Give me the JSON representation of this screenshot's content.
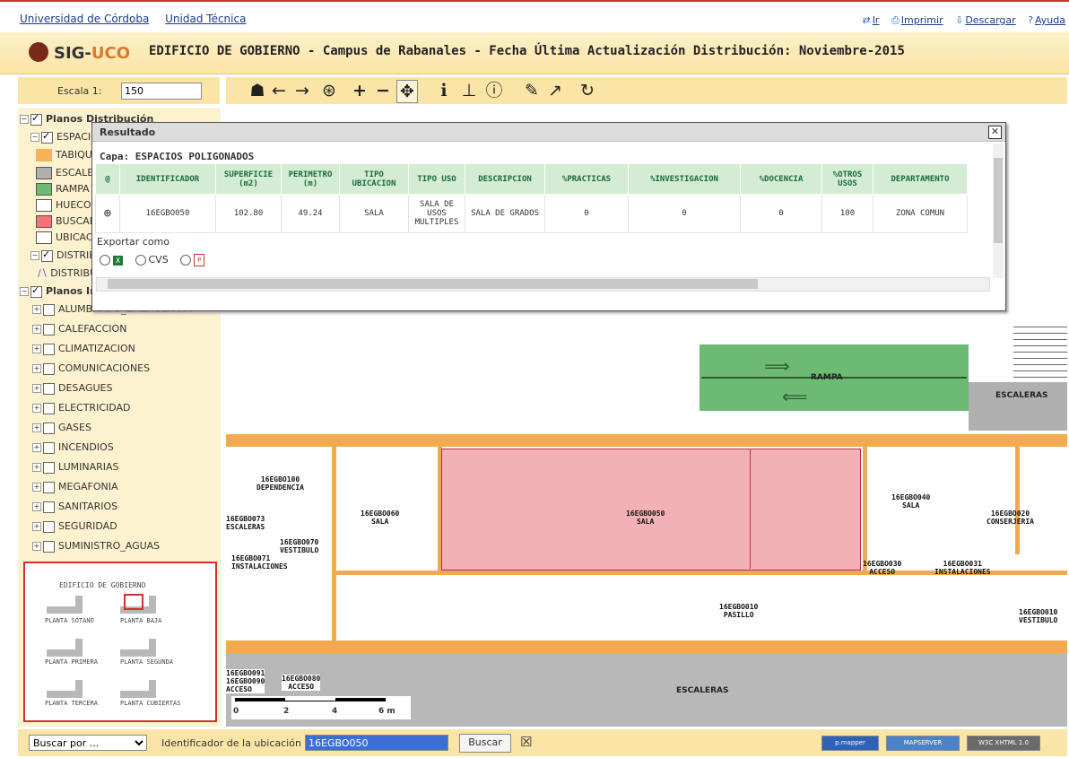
{
  "topbar": {
    "links": [
      "Universidad de Córdoba",
      "Unidad Técnica"
    ],
    "actions": [
      {
        "icon": "go-icon",
        "label": "Ir"
      },
      {
        "icon": "print-icon",
        "label": "Imprimir"
      },
      {
        "icon": "download-icon",
        "label": "Descargar"
      },
      {
        "icon": "help-icon",
        "label": "Ayuda"
      }
    ]
  },
  "header": {
    "logo_text": "SIG-",
    "logo_accent": "UCO",
    "title": "EDIFICIO DE GOBIERNO - Campus de Rabanales - Fecha Última Actualización Distribución: Noviembre-2015"
  },
  "scale": {
    "label": "Escala 1:",
    "value": "150"
  },
  "toolbar": {
    "tools": [
      {
        "name": "home-icon",
        "glyph": "☗"
      },
      {
        "name": "back-icon",
        "glyph": "←"
      },
      {
        "name": "forward-icon",
        "glyph": "→"
      },
      {
        "name": "zoom-extent-icon",
        "glyph": "⊛"
      },
      {
        "name": "zoom-in-icon",
        "glyph": "+"
      },
      {
        "name": "zoom-out-icon",
        "glyph": "−"
      },
      {
        "name": "pan-icon",
        "glyph": "✥"
      },
      {
        "name": "info-icon",
        "glyph": "i"
      },
      {
        "name": "query-icon",
        "glyph": "⊥"
      },
      {
        "name": "identify-icon",
        "glyph": "ⓘ"
      },
      {
        "name": "measure-icon",
        "glyph": "✎"
      },
      {
        "name": "select-icon",
        "glyph": "↗"
      },
      {
        "name": "refresh-icon",
        "glyph": "↻"
      }
    ]
  },
  "layers": {
    "group1_label": "Planos Distribución",
    "sub1_label": "ESPACIOS POLIGONADOS",
    "legend": [
      {
        "label": "TABIQUES",
        "color": "#f3b356"
      },
      {
        "label": "ESCALERAS",
        "color": "#b0b0b0"
      },
      {
        "label": "RAMPA",
        "color": "#6dbb72"
      },
      {
        "label": "HUECO",
        "color": "#ffffff"
      },
      {
        "label": "BUSCADO",
        "color": "#f4727a"
      },
      {
        "label": "UBICACION",
        "color": "#ffffff"
      }
    ],
    "sub2_label": "DISTRIBUCION",
    "sub2_item": "DISTRIBUCION",
    "group2_label": "Planos Instalaciones",
    "installations": [
      "ALUMBRADO_EMERGENCIA",
      "CALEFACCION",
      "CLIMATIZACION",
      "COMUNICACIONES",
      "DESAGUES",
      "ELECTRICIDAD",
      "GASES",
      "INCENDIOS",
      "LUMINARIAS",
      "MEGAFONIA",
      "SANITARIOS",
      "SEGURIDAD",
      "SUMINISTRO_AGUAS"
    ]
  },
  "minimap": {
    "title": "EDIFICIO DE GOBIERNO",
    "floors": [
      "PLANTA SÓTANO",
      "PLANTA BAJA",
      "PLANTA PRIMERA",
      "PLANTA SEGUNDA",
      "PLANTA TERCERA",
      "PLANTA CUBIERTAS"
    ]
  },
  "popup": {
    "title": "Resultado",
    "layer_label": "Capa: ESPACIOS POLIGONADOS",
    "columns": [
      "@",
      "IDENTIFICADOR",
      "SUPERFICIE (m2)",
      "PERIMETRO (m)",
      "TIPO UBICACION",
      "TIPO USO",
      "DESCRIPCION",
      "%PRACTICAS",
      "%INVESTIGACION",
      "%DOCENCIA",
      "%OTROS USOS",
      "DEPARTAMENTO"
    ],
    "rows": [
      [
        "",
        "16EGBO050",
        "102.80",
        "49.24",
        "SALA",
        "SALA DE USOS MULTIPLES",
        "SALA DE GRADOS",
        "0",
        "0",
        "0",
        "100",
        "ZONA COMUN"
      ]
    ],
    "export_label": "Exportar como",
    "export_options": [
      "",
      "CVS",
      ""
    ]
  },
  "map": {
    "rampa": "RAMPA",
    "escaleras_top": "ESCALERAS",
    "escaleras_bottom": "ESCALERAS",
    "rooms": [
      "16EGBO100\nDEPENDENCIA",
      "16EGBO073\nESCALERAS",
      "16EGBO070\nVESTIBULO",
      "16EGBO071\nINSTALACIONES",
      "16EGBO060\nSALA",
      "16EGBO050\nSALA",
      "16EGBO040\nSALA",
      "16EGBO020\nCONSERJERIA",
      "16EGBO030\nACCESO",
      "16EGBO031\nINSTALACIONES",
      "16EGBO010\nPASILLO",
      "16EGBO010\nVESTIBULO",
      "16EGBO091\n16EGBO090\nACCESO",
      "16EGBO080\nACCESO"
    ],
    "scale_ticks": [
      "0",
      "2",
      "4",
      "6 m"
    ]
  },
  "bottombar": {
    "search_by": "Buscar por ...",
    "id_label": "Identificador de la ubicación",
    "id_value": "16EGBO050",
    "search_button": "Buscar",
    "badges": [
      "p.mapper",
      "MAPSERVER",
      "W3C XHTML 1.0"
    ]
  }
}
